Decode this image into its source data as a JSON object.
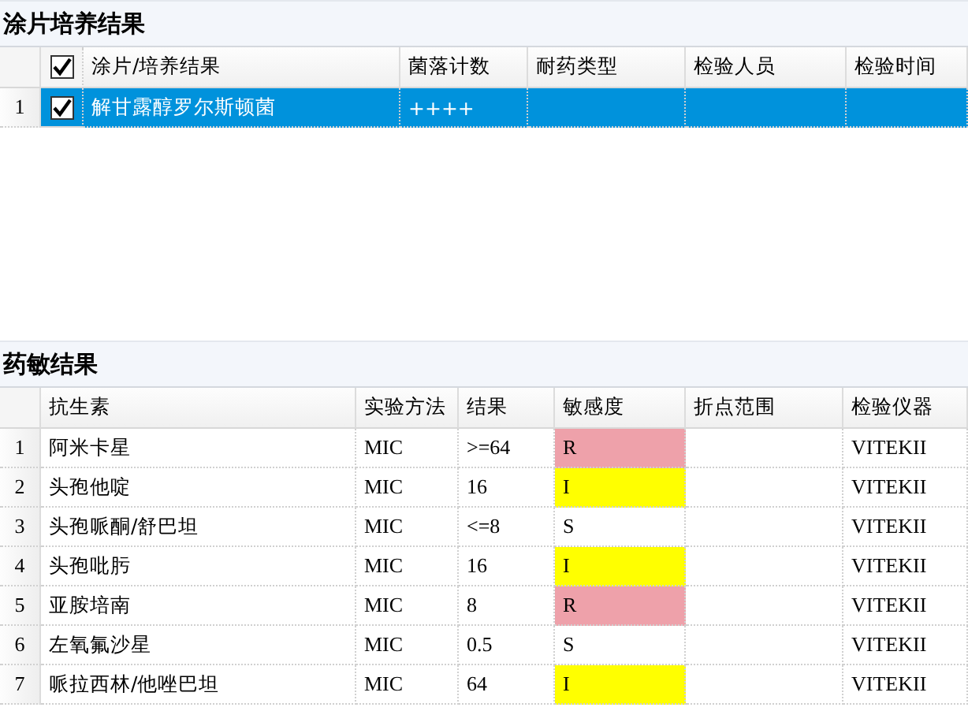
{
  "culture": {
    "title": "涂片培养结果",
    "header_checked": true,
    "columns": [
      "涂片/培养结果",
      "菌落计数",
      "耐药类型",
      "检验人员",
      "检验时间"
    ],
    "rows": [
      {
        "index": "1",
        "checked": true,
        "selected": true,
        "cells": [
          "解甘露醇罗尔斯顿菌",
          "++++",
          "",
          "",
          ""
        ]
      }
    ]
  },
  "susceptibility": {
    "title": "药敏结果",
    "columns": [
      "抗生素",
      "实验方法",
      "结果",
      "敏感度",
      "折点范围",
      "检验仪器"
    ],
    "rows": [
      {
        "index": "1",
        "antibiotic": "阿米卡星",
        "method": "MIC",
        "result": ">=64",
        "sensitivity": "R",
        "color": "#eea1aa",
        "instrument": "VITEKII"
      },
      {
        "index": "2",
        "antibiotic": "头孢他啶",
        "method": "MIC",
        "result": "16",
        "sensitivity": "I",
        "color": "#ffff00",
        "instrument": "VITEKII"
      },
      {
        "index": "3",
        "antibiotic": "头孢哌酮/舒巴坦",
        "method": "MIC",
        "result": "<=8",
        "sensitivity": "S",
        "color": "#ffffff",
        "instrument": "VITEKII"
      },
      {
        "index": "4",
        "antibiotic": "头孢吡肟",
        "method": "MIC",
        "result": "16",
        "sensitivity": "I",
        "color": "#ffff00",
        "instrument": "VITEKII"
      },
      {
        "index": "5",
        "antibiotic": "亚胺培南",
        "method": "MIC",
        "result": "8",
        "sensitivity": "R",
        "color": "#eea1aa",
        "instrument": "VITEKII"
      },
      {
        "index": "6",
        "antibiotic": "左氧氟沙星",
        "method": "MIC",
        "result": "0.5",
        "sensitivity": "S",
        "color": "#ffffff",
        "instrument": "VITEKII"
      },
      {
        "index": "7",
        "antibiotic": "哌拉西林/他唑巴坦",
        "method": "MIC",
        "result": "64",
        "sensitivity": "I",
        "color": "#ffff00",
        "instrument": "VITEKII"
      }
    ]
  }
}
